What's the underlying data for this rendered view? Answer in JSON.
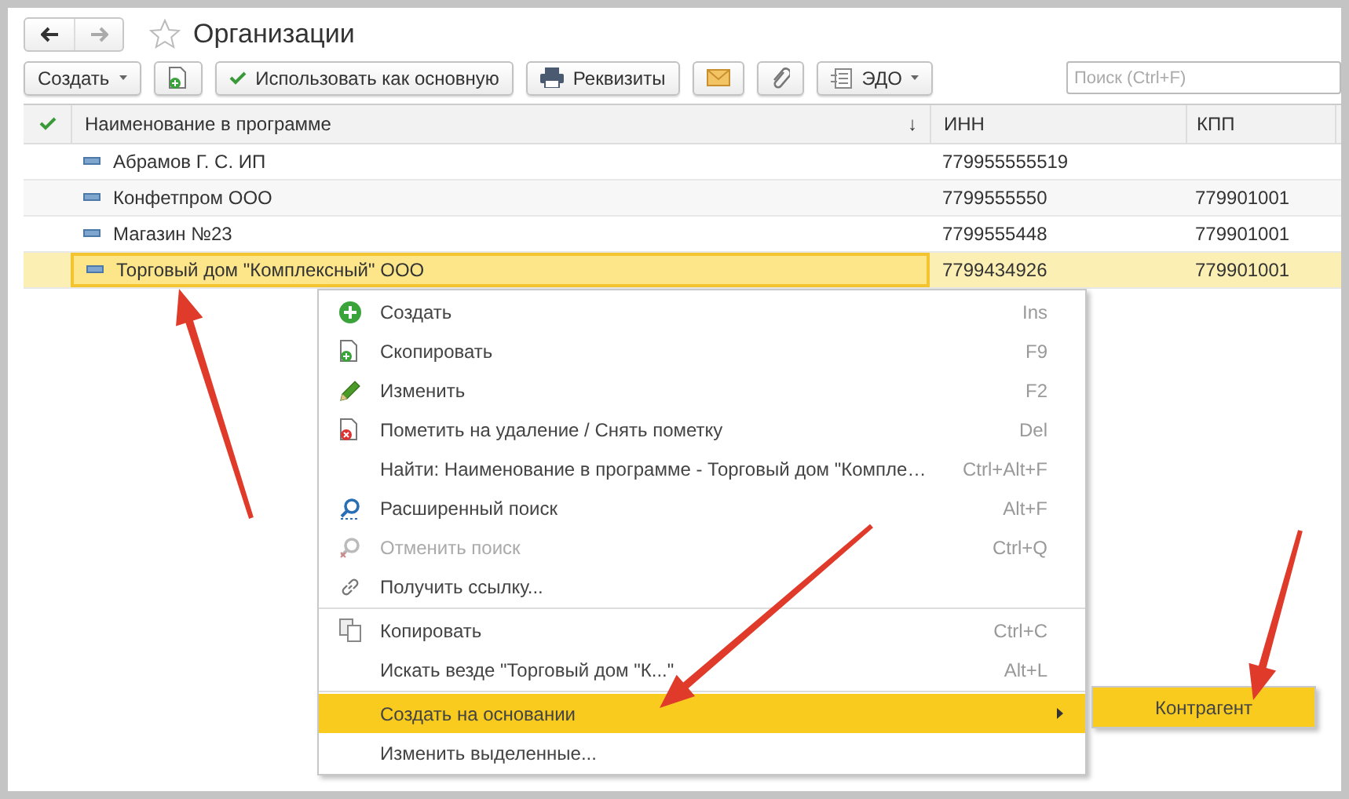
{
  "window": {
    "title": "Организации"
  },
  "toolbar": {
    "buttons": [
      {
        "kind": "dropdown",
        "label": "Создать"
      },
      {
        "kind": "icon"
      },
      {
        "kind": "text",
        "label": "Использовать как основную"
      },
      {
        "kind": "text",
        "label": "Реквизиты"
      },
      {
        "kind": "icon"
      },
      {
        "kind": "icon"
      },
      {
        "kind": "dropdown",
        "label": "ЭДО"
      }
    ],
    "search": {
      "placeholder": "Поиск (Ctrl+F)"
    }
  },
  "table": {
    "columns": [
      {
        "label": "Наименование в программе",
        "sort": "↓"
      },
      {
        "label": "ИНН"
      },
      {
        "label": "КПП"
      }
    ],
    "rows": [
      {
        "name": "Абрамов Г. С. ИП",
        "inn": "779955555519",
        "selected": false
      },
      {
        "name": "Конфетпром ООО",
        "inn": "7799555550",
        "kpp": "779901001",
        "selected": false
      },
      {
        "name": "Магазин №23",
        "inn": "7799555448",
        "kpp": "779901001",
        "selected": false
      },
      {
        "name": "Торговый дом \"Комплексный\" ООО",
        "inn": "7799434926",
        "kpp": "779901001",
        "selected": true
      }
    ]
  },
  "context_menu": {
    "items": [
      {
        "kind": "item",
        "label": "Создать",
        "shortcut": "Ins",
        "disabled": false,
        "selected": false
      },
      {
        "kind": "item",
        "label": "Скопировать",
        "shortcut": "F9",
        "disabled": false,
        "selected": false
      },
      {
        "kind": "item",
        "label": "Изменить",
        "shortcut": "F2",
        "disabled": false,
        "selected": false
      },
      {
        "kind": "item",
        "label": "Пометить на удаление / Снять пометку",
        "shortcut": "Del",
        "disabled": false,
        "selected": false
      },
      {
        "kind": "item",
        "label": "Найти: Наименование в программе - Торговый дом \"Компле…",
        "shortcut": "Ctrl+Alt+F",
        "disabled": false,
        "selected": false
      },
      {
        "kind": "item",
        "label": "Расширенный поиск",
        "shortcut": "Alt+F",
        "disabled": false,
        "selected": false
      },
      {
        "kind": "item",
        "label": "Отменить поиск",
        "shortcut": "Ctrl+Q",
        "disabled": true,
        "selected": false
      },
      {
        "kind": "item",
        "label": "Получить ссылку...",
        "disabled": false,
        "selected": false
      },
      {
        "kind": "separator"
      },
      {
        "kind": "item",
        "label": "Копировать",
        "shortcut": "Ctrl+C",
        "disabled": false,
        "selected": false
      },
      {
        "kind": "item",
        "label": "Искать везде \"Торговый дом \"К...\"",
        "shortcut": "Alt+L",
        "disabled": false,
        "selected": false
      },
      {
        "kind": "separator"
      },
      {
        "kind": "item",
        "label": "Создать на основании",
        "submenu": true,
        "disabled": false,
        "selected": true
      },
      {
        "kind": "item",
        "label": "Изменить выделенные...",
        "disabled": false,
        "selected": false
      }
    ],
    "submenu": {
      "items": [
        {
          "label": "Контрагент",
          "selected": true
        }
      ]
    }
  }
}
